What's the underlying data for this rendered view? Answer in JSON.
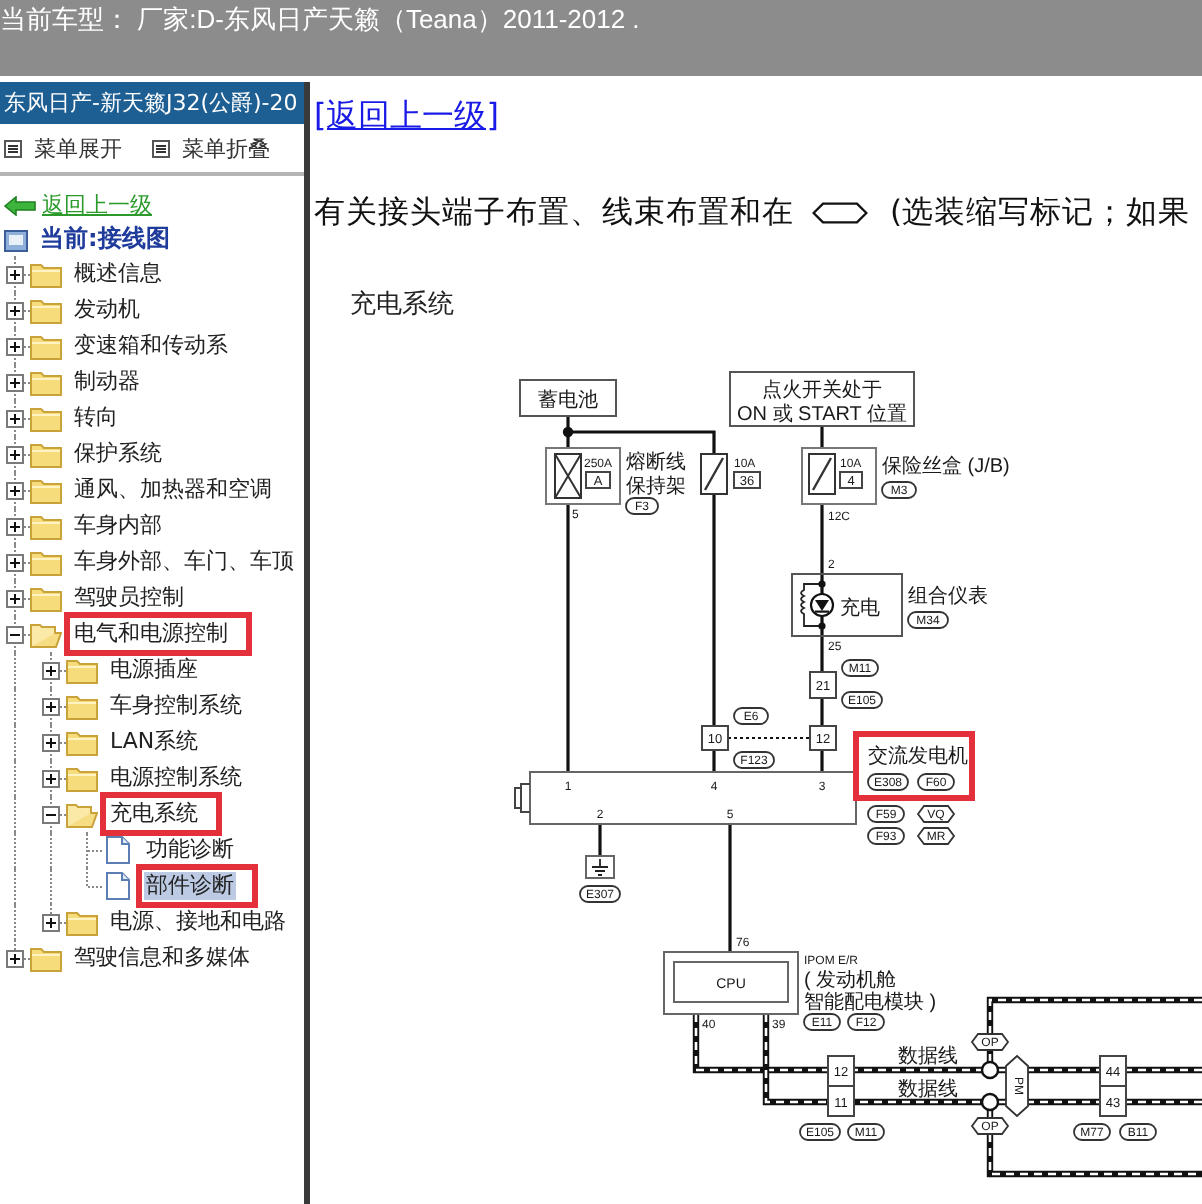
{
  "top_bar": {
    "text": "当前车型： 厂家:D-东风日产天籁（Teana）2011-2012 ."
  },
  "sidebar": {
    "title": "东风日产-新天籁J32(公爵)-20",
    "menu": [
      "菜单展开",
      "菜单折叠"
    ],
    "back_link": "返回上一级",
    "current": "当前:接线图",
    "items": [
      {
        "label": "概述信息",
        "kind": "folder",
        "expanded": false,
        "selected": false,
        "highlighted": false
      },
      {
        "label": "发动机",
        "kind": "folder",
        "expanded": false,
        "selected": false,
        "highlighted": false
      },
      {
        "label": "变速箱和传动系",
        "kind": "folder",
        "expanded": false,
        "selected": false,
        "highlighted": false
      },
      {
        "label": "制动器",
        "kind": "folder",
        "expanded": false,
        "selected": false,
        "highlighted": false
      },
      {
        "label": "转向",
        "kind": "folder",
        "expanded": false,
        "selected": false,
        "highlighted": false
      },
      {
        "label": "保护系统",
        "kind": "folder",
        "expanded": false,
        "selected": false,
        "highlighted": false
      },
      {
        "label": "通风、加热器和空调",
        "kind": "folder",
        "expanded": false,
        "selected": false,
        "highlighted": false
      },
      {
        "label": "车身内部",
        "kind": "folder",
        "expanded": false,
        "selected": false,
        "highlighted": false
      },
      {
        "label": "车身外部、车门、车顶",
        "kind": "folder",
        "expanded": false,
        "selected": false,
        "highlighted": false
      },
      {
        "label": "驾驶员控制",
        "kind": "folder",
        "expanded": false,
        "selected": false,
        "highlighted": false
      },
      {
        "label": "电气和电源控制",
        "kind": "folder",
        "expanded": true,
        "selected": false,
        "highlighted": true,
        "children": [
          {
            "label": "电源插座",
            "kind": "folder",
            "expanded": false,
            "selected": false,
            "highlighted": false
          },
          {
            "label": "车身控制系统",
            "kind": "folder",
            "expanded": false,
            "selected": false,
            "highlighted": false
          },
          {
            "label": "LAN系统",
            "kind": "folder",
            "expanded": false,
            "selected": false,
            "highlighted": false
          },
          {
            "label": "电源控制系统",
            "kind": "folder",
            "expanded": false,
            "selected": false,
            "highlighted": false
          },
          {
            "label": "充电系统",
            "kind": "folder",
            "expanded": true,
            "selected": false,
            "highlighted": true,
            "children": [
              {
                "label": "功能诊断",
                "kind": "document",
                "selected": false,
                "highlighted": false
              },
              {
                "label": "部件诊断",
                "kind": "document",
                "selected": true,
                "highlighted": true
              }
            ]
          },
          {
            "label": "电源、接地和电路",
            "kind": "folder",
            "expanded": false,
            "selected": false,
            "highlighted": false
          }
        ]
      },
      {
        "label": "驾驶信息和多媒体",
        "kind": "folder",
        "expanded": false,
        "selected": false,
        "highlighted": false
      }
    ]
  },
  "content": {
    "back_link": "[返回上一级]",
    "intro": {
      "before_symbol": "有关接头端子布置、线束布置和在",
      "after_symbol": "(选装缩写标记；如果"
    },
    "diagram": {
      "title": "充电系统",
      "battery": "蓄电池",
      "ignition_switch": [
        "点火开关处于",
        "ON 或 START 位置"
      ],
      "fusible_link": {
        "rating": "250A",
        "number": "A",
        "label": [
          "熔断线",
          "保持架"
        ],
        "tag": "F3",
        "pin": "5"
      },
      "fuse": {
        "rating": "10A",
        "number": "36"
      },
      "fuse_block": {
        "rating": "10A",
        "number": "4",
        "label": "保险丝盒 (J/B)",
        "tag": "M3",
        "pin": "12C"
      },
      "combination_meter": {
        "pins": [
          "2",
          "25"
        ],
        "lamp": "充电",
        "label": "组合仪表",
        "tag": "M34"
      },
      "joint_connectors": [
        {
          "pins": [
            "21"
          ],
          "tags": [
            "M11",
            "E105"
          ]
        },
        {
          "pins": [
            "10",
            "12"
          ],
          "tags": [
            "E6",
            "F123"
          ]
        }
      ],
      "alternator": {
        "label": "交流发电机",
        "highlighted": true,
        "top_pins": [
          "1",
          "4",
          "3"
        ],
        "bottom_pins": [
          "2",
          "5"
        ],
        "tags": [
          {
            "text": "E308",
            "kind": "oval"
          },
          {
            "text": "F60",
            "kind": "oval"
          },
          {
            "text": "F59",
            "kind": "oval"
          },
          {
            "text": "VQ",
            "kind": "hex"
          },
          {
            "text": "F93",
            "kind": "oval"
          },
          {
            "text": "MR",
            "kind": "hex"
          }
        ]
      },
      "ground": {
        "tag": "E307"
      },
      "ipom": {
        "chip": "CPU",
        "label": [
          "IPOM E/R",
          "( 发动机舱",
          "智能配电模块 )"
        ],
        "tags": [
          "E11",
          "F12"
        ],
        "pins": [
          "76",
          "40",
          "39"
        ]
      },
      "data_lines": {
        "labels": [
          "数据线",
          "数据线"
        ],
        "connectors": [
          {
            "pins": [
              "12",
              "11"
            ],
            "tags": [
              "E105",
              "M11"
            ]
          },
          {
            "pins": [
              "44",
              "43"
            ],
            "tags": [
              "M77",
              "B11"
            ]
          }
        ],
        "splice_tags": [
          "OP",
          "OP"
        ],
        "splice": "PM"
      }
    }
  }
}
